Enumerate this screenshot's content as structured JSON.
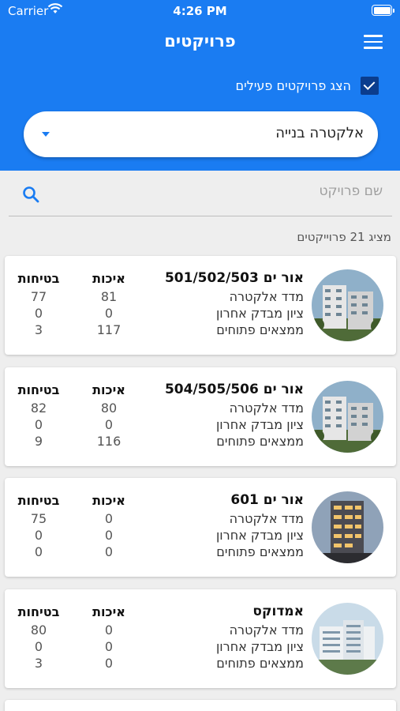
{
  "status_bar": {
    "carrier": "Carrier",
    "time": "4:26 PM"
  },
  "header": {
    "title": "פרויקטים",
    "menu_icon": "hamburger-menu-icon",
    "show_active_label": "הצג פרויקטים פעילים",
    "show_active_checked": true,
    "company_select_value": "אלקטרה בנייה",
    "accent_color": "#1a7cf2"
  },
  "search": {
    "placeholder": "שם פרויקט",
    "icon": "search-icon"
  },
  "list_count_label": "מציג 21 פרוייקטים",
  "row_labels": {
    "index": "מדד אלקטרה",
    "last_score": "ציון מבדק אחרון",
    "open_findings": "ממצאים פתוחים"
  },
  "col_labels": {
    "quality": "איכות",
    "safety": "בטיחות"
  },
  "projects": [
    {
      "name": "אור ים 501/502/503",
      "quality": [
        "81",
        "0",
        "117"
      ],
      "safety": [
        "77",
        "0",
        "3"
      ]
    },
    {
      "name": "אור ים 504/505/506",
      "quality": [
        "80",
        "0",
        "116"
      ],
      "safety": [
        "82",
        "0",
        "9"
      ]
    },
    {
      "name": "אור ים 601",
      "quality": [
        "0",
        "0",
        "0"
      ],
      "safety": [
        "75",
        "0",
        "0"
      ]
    },
    {
      "name": "אמדוקס",
      "quality": [
        "0",
        "0",
        "0"
      ],
      "safety": [
        "80",
        "0",
        "3"
      ]
    }
  ]
}
